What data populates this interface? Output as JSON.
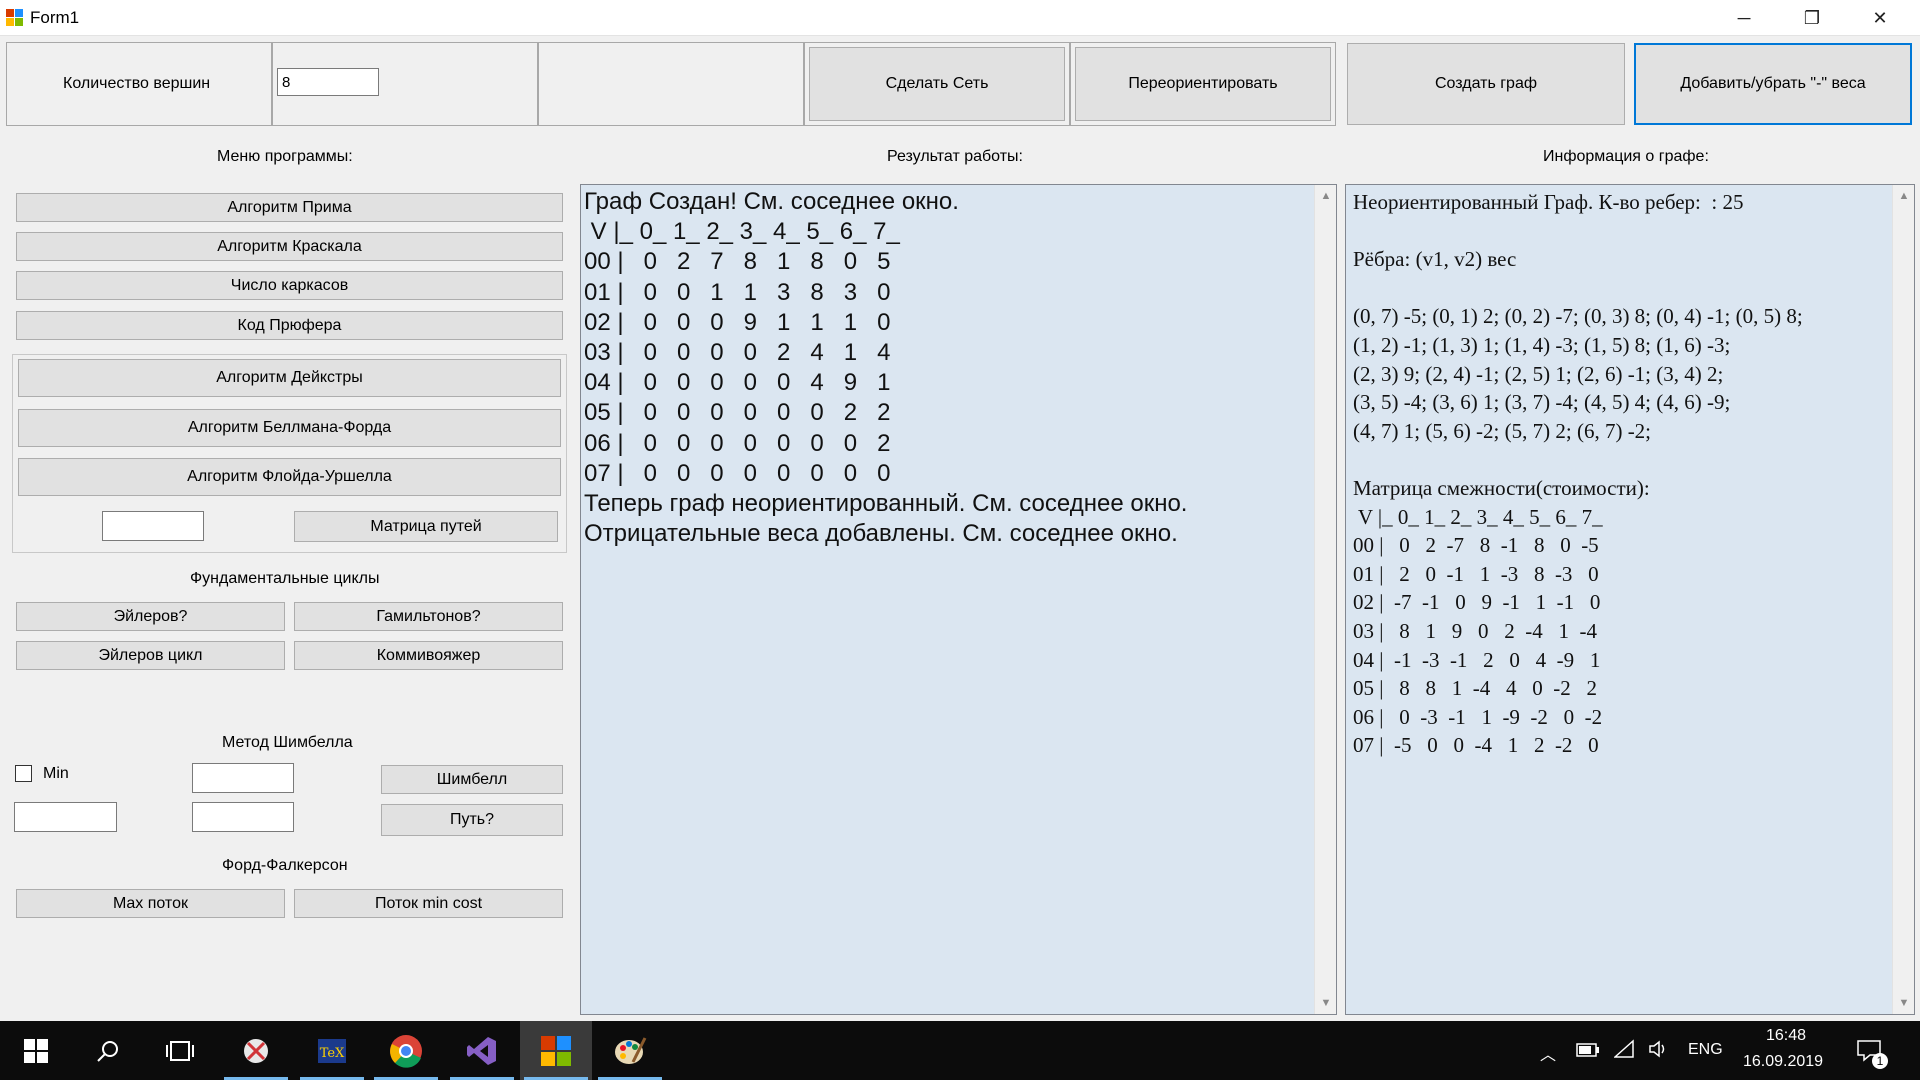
{
  "window": {
    "title": "Form1",
    "minimize": "─",
    "restore": "❐",
    "close": "✕"
  },
  "top": {
    "vertex_count_label": "Количество вершин",
    "vertex_count_value": "8",
    "make_net": "Сделать Сеть",
    "reorient": "Переориентировать",
    "create_graph": "Создать граф",
    "add_remove_neg": "Добавить/убрать \"-\" веса"
  },
  "menu": {
    "header": "Меню программы:",
    "prim": "Алгоритм Прима",
    "kruskal": "Алгоритм Краскала",
    "spanning_count": "Число каркасов",
    "prufer": "Код Прюфера",
    "dijkstra": "Алгоритм Дейкстры",
    "bellman": "Алгоритм Беллмана-Форда",
    "floyd": "Алгоритм Флойда-Уршелла",
    "path_matrix": "Матрица путей",
    "path_matrix_input": "",
    "fund_cycles": "Фундаментальные циклы",
    "euler_q": "Эйлеров?",
    "hamilton_q": "Гамильтонов?",
    "euler_cycle": "Эйлеров цикл",
    "salesman": "Коммивояжер",
    "shimbel_header": "Метод Шимбелла",
    "min_label": "Min",
    "min_checked": false,
    "shimbel_input1": "",
    "shimbel_input2": "",
    "shimbel_input3": "",
    "shimbel": "Шимбелл",
    "path_q": "Путь?",
    "ford_header": "Форд-Фалкерсон",
    "max_flow": "Max поток",
    "min_cost_flow": "Поток min cost"
  },
  "result": {
    "header": "Результат работы:",
    "lines": [
      "Граф Создан! См. соседнее окно.",
      " V |_ 0_ 1_ 2_ 3_ 4_ 5_ 6_ 7_",
      "00 |   0   2   7   8   1   8   0   5",
      "01 |   0   0   1   1   3   8   3   0",
      "02 |   0   0   0   9   1   1   1   0",
      "03 |   0   0   0   0   2   4   1   4",
      "04 |   0   0   0   0   0   4   9   1",
      "05 |   0   0   0   0   0   0   2   2",
      "06 |   0   0   0   0   0   0   0   2",
      "07 |   0   0   0   0   0   0   0   0",
      "Теперь граф неориентированный. См. соседнее окно.",
      "Отрицательные веса добавлены. См. соседнее окно."
    ]
  },
  "info": {
    "header": "Информация о графе:",
    "lines": [
      "Неориентированный Граф. К-во ребер:  : 25",
      "",
      "Рёбра: (v1, v2) вес",
      "",
      "(0, 7) -5; (0, 1) 2; (0, 2) -7; (0, 3) 8; (0, 4) -1; (0, 5) 8;",
      "(1, 2) -1; (1, 3) 1; (1, 4) -3; (1, 5) 8; (1, 6) -3;",
      "(2, 3) 9; (2, 4) -1; (2, 5) 1; (2, 6) -1; (3, 4) 2;",
      "(3, 5) -4; (3, 6) 1; (3, 7) -4; (4, 5) 4; (4, 6) -9;",
      "(4, 7) 1; (5, 6) -2; (5, 7) 2; (6, 7) -2;",
      "",
      "Матрица смежности(стоимости):",
      " V |_ 0_ 1_ 2_ 3_ 4_ 5_ 6_ 7_",
      "00 |   0   2  -7   8  -1   8   0  -5",
      "01 |   2   0  -1   1  -3   8  -3   0",
      "02 |  -7  -1   0   9  -1   1  -1   0",
      "03 |   8   1   9   0   2  -4   1  -4",
      "04 |  -1  -3  -1   2   0   4  -9   1",
      "05 |   8   8   1  -4   4   0  -2   2",
      "06 |   0  -3  -1   1  -9  -2   0  -2",
      "07 |  -5   0   0  -4   1   2  -2   0"
    ]
  },
  "taskbar": {
    "apps": [
      "windows-logo-icon",
      "search-icon",
      "task-view-icon",
      "snipping-tool-icon",
      "texstudio-icon",
      "chrome-icon",
      "visual-studio-icon",
      "form-app-icon",
      "paint-icon"
    ],
    "lang": "ENG",
    "time": "16:48",
    "date": "16.09.2019",
    "notif_count": "1"
  }
}
